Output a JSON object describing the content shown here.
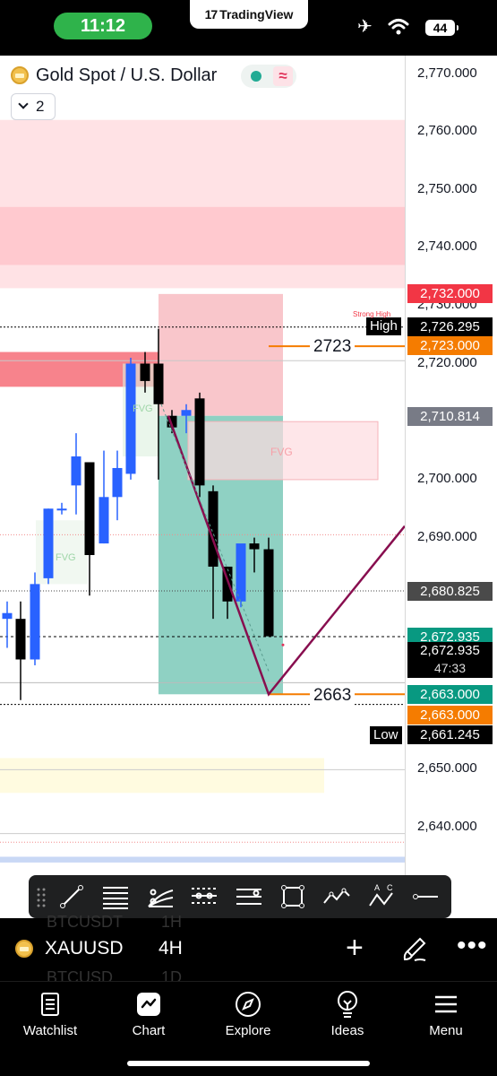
{
  "status_bar": {
    "time": "11:12",
    "app_banner": "TradingView",
    "battery": "44",
    "icons": [
      "airplane-icon",
      "wifi-icon",
      "battery-icon"
    ]
  },
  "chart": {
    "title": "Gold Spot / U.S. Dollar",
    "collapse_count": "2",
    "price_ticks": [
      "2,770.000",
      "2,760.000",
      "2,750.000",
      "2,740.000",
      "2,730.000",
      "2,720.000",
      "2,700.000",
      "2,690.000",
      "2,650.000",
      "2,640.000"
    ],
    "labels": {
      "resistance": "2,732.000",
      "high": "2,726.295",
      "orange_top": "2,723.000",
      "gray_level": "2,710.814",
      "dark_level": "2,680.825",
      "current": "2,672.935",
      "countdown_price": "2,672.935",
      "countdown": "47:33",
      "target_green": "2,663.000",
      "target_orange": "2,663.000",
      "low": "2,661.245"
    },
    "tags": {
      "high": "High",
      "low": "Low"
    },
    "level_texts": {
      "upper": "2723",
      "lower": "2663"
    },
    "annotations": {
      "fvg": "FVG",
      "strong_high": "Strong High"
    },
    "colors": {
      "bull": "#2962ff",
      "bear": "#000000",
      "supply_zone": "#f7525f",
      "target_green": "#089981",
      "orange": "#f57c00",
      "resistance_red": "#f23645",
      "path": "#880e4f"
    },
    "chart_data": {
      "type": "candlestick",
      "interval": "4H",
      "symbol": "XAUUSD",
      "ylim": [
        2634,
        2778
      ],
      "candles": [
        {
          "o": 2676,
          "h": 2679,
          "l": 2671,
          "c": 2677
        },
        {
          "o": 2676,
          "h": 2679,
          "l": 2662,
          "c": 2669
        },
        {
          "o": 2669,
          "h": 2684,
          "l": 2668,
          "c": 2682
        },
        {
          "o": 2683,
          "h": 2695,
          "l": 2682,
          "c": 2695
        },
        {
          "o": 2695,
          "h": 2696,
          "l": 2694,
          "c": 2695
        },
        {
          "o": 2699,
          "h": 2708,
          "l": 2694,
          "c": 2704
        },
        {
          "o": 2703,
          "h": 2703,
          "l": 2680,
          "c": 2687
        },
        {
          "o": 2689,
          "h": 2705,
          "l": 2689,
          "c": 2697
        },
        {
          "o": 2697,
          "h": 2705,
          "l": 2693,
          "c": 2702
        },
        {
          "o": 2701,
          "h": 2721,
          "l": 2700,
          "c": 2720
        },
        {
          "o": 2720,
          "h": 2722,
          "l": 2715,
          "c": 2717
        },
        {
          "o": 2720,
          "h": 2726,
          "l": 2700,
          "c": 2713
        },
        {
          "o": 2711,
          "h": 2712,
          "l": 2708,
          "c": 2709
        },
        {
          "o": 2711,
          "h": 2713,
          "l": 2708,
          "c": 2712
        },
        {
          "o": 2714,
          "h": 2715,
          "l": 2697,
          "c": 2699
        },
        {
          "o": 2698,
          "h": 2699,
          "l": 2676,
          "c": 2685
        },
        {
          "o": 2685,
          "h": 2685,
          "l": 2676,
          "c": 2679
        },
        {
          "o": 2679,
          "h": 2688,
          "l": 2678,
          "c": 2689
        },
        {
          "o": 2689,
          "h": 2690,
          "l": 2684,
          "c": 2688
        },
        {
          "o": 2688,
          "h": 2690,
          "l": 2674,
          "c": 2673
        }
      ],
      "zones": [
        {
          "name": "supply-zone-top",
          "y1": 2733,
          "y2": 2762
        },
        {
          "name": "supply-zone-strong",
          "y1": 2737,
          "y2": 2747
        },
        {
          "name": "red-block",
          "y1": 2716,
          "y2": 2722
        },
        {
          "name": "short-stop-zone",
          "y1": 2711,
          "y2": 2732
        },
        {
          "name": "short-target-zone",
          "y1": 2663,
          "y2": 2711
        },
        {
          "name": "fvg-right",
          "y1": 2700,
          "y2": 2710
        },
        {
          "name": "demand-zone",
          "y1": 2646,
          "y2": 2652
        }
      ],
      "projection_path": [
        2711,
        2663,
        2692
      ],
      "levels": [
        2732,
        2726.295,
        2723,
        2710.814,
        2680.825,
        2672.935,
        2663,
        2661.245
      ]
    }
  },
  "symbol_row": {
    "ticker": "XAUUSD",
    "interval": "4H",
    "ghost_tickers": [
      "BTCUSDT",
      "BTCUSD"
    ],
    "ghost_intervals": [
      "1H",
      "1D"
    ]
  },
  "nav": {
    "items": [
      {
        "label": "Watchlist"
      },
      {
        "label": "Chart"
      },
      {
        "label": "Explore"
      },
      {
        "label": "Ideas"
      },
      {
        "label": "Menu"
      }
    ]
  }
}
